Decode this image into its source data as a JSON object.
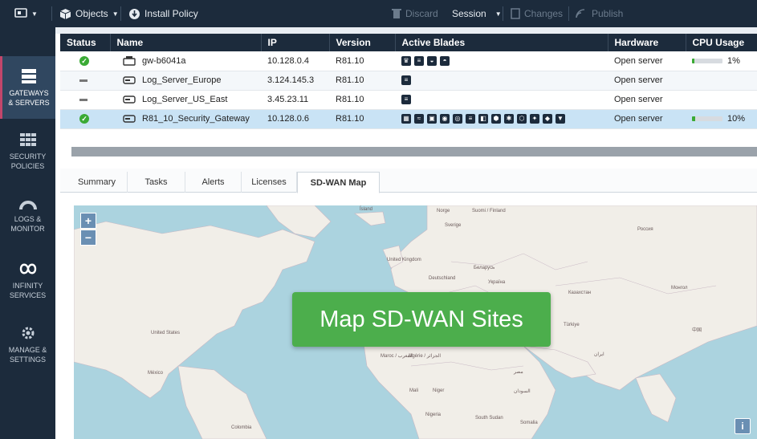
{
  "toolbar": {
    "objects_label": "Objects",
    "install_policy_label": "Install Policy",
    "discard_label": "Discard",
    "session_label": "Session",
    "changes_label": "Changes",
    "publish_label": "Publish"
  },
  "nav": {
    "items": [
      {
        "line1": "GATEWAYS",
        "line2": "& SERVERS",
        "icon": "gateways-servers-icon"
      },
      {
        "line1": "SECURITY",
        "line2": "POLICIES",
        "icon": "security-policies-icon"
      },
      {
        "line1": "LOGS &",
        "line2": "MONITOR",
        "icon": "logs-monitor-icon"
      },
      {
        "line1": "INFINITY",
        "line2": "SERVICES",
        "icon": "infinity-services-icon"
      },
      {
        "line1": "MANAGE &",
        "line2": "SETTINGS",
        "icon": "manage-settings-icon"
      }
    ]
  },
  "grid": {
    "headers": [
      "Status",
      "Name",
      "IP",
      "Version",
      "Active Blades",
      "Hardware",
      "CPU Usage"
    ],
    "rows": [
      {
        "status": "ok",
        "name": "gw-b6041a",
        "ip": "10.128.0.4",
        "version": "R81.10",
        "hardware": "Open server",
        "cpu_text": "1%",
        "cpu_value": 0.01
      },
      {
        "status": "na",
        "name": "Log_Server_Europe",
        "ip": "3.124.145.3",
        "version": "R81.10",
        "hardware": "Open server",
        "cpu_text": "",
        "cpu_value": null
      },
      {
        "status": "na",
        "name": "Log_Server_US_East",
        "ip": "3.45.23.11",
        "version": "R81.10",
        "hardware": "Open server",
        "cpu_text": "",
        "cpu_value": null
      },
      {
        "status": "ok",
        "name": "R81_10_Security_Gateway",
        "ip": "10.128.0.6",
        "version": "R81.10",
        "hardware": "Open server",
        "cpu_text": "10%",
        "cpu_value": 0.1
      }
    ]
  },
  "tabs": [
    "Summary",
    "Tasks",
    "Alerts",
    "Licenses",
    "SD-WAN Map"
  ],
  "active_tab": "SD-WAN Map",
  "map": {
    "zoom_in": "+",
    "zoom_out": "−",
    "cta_label": "Map SD-WAN Sites",
    "info_label": "i",
    "labels": [
      "Ísland",
      "Norge",
      "Sverige",
      "Suomi / Finland",
      "Россия",
      "United Kingdom",
      "Deutschland",
      "Беларусь",
      "Україна",
      "Казахстан",
      "Монгол",
      "Türkiye",
      "United States",
      "México",
      "Maroc / المغرب",
      "Algérie / الجزائر",
      "Mali",
      "Niger",
      "Nigeria",
      "مصر",
      "السودان",
      "South Sudan",
      "Colombia",
      "Somalia",
      "ایران",
      "中国"
    ],
    "colors": {
      "water": "#abd3df",
      "land": "#f1eee8",
      "cta": "#4cae4c"
    }
  }
}
